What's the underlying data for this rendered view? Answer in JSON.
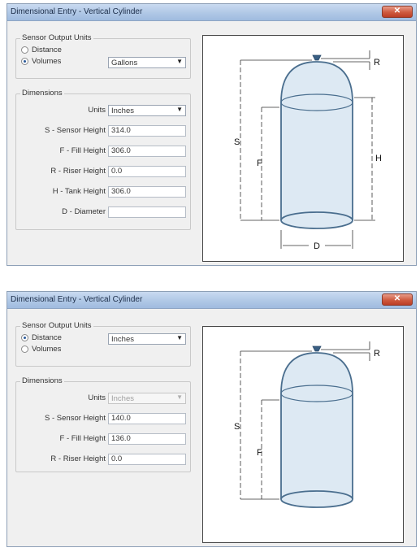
{
  "window_title": "Dimensional Entry - Vertical Cylinder",
  "close_glyph": "✕",
  "dropdown_arrow": "▼",
  "panels": [
    {
      "sensor_output_units": {
        "legend": "Sensor Output Units",
        "options": [
          {
            "label": "Distance",
            "checked": false
          },
          {
            "label": "Volumes",
            "checked": true
          }
        ],
        "select_value": "Gallons"
      },
      "dimensions": {
        "legend": "Dimensions",
        "units_label": "Units",
        "units_value": "Inches",
        "fields": [
          {
            "label": "S - Sensor Height",
            "value": "314.0"
          },
          {
            "label": "F - Fill Height",
            "value": "306.0"
          },
          {
            "label": "R - Riser Height",
            "value": "0.0"
          },
          {
            "label": "H - Tank Height",
            "value": "306.0"
          },
          {
            "label": "D - Diameter",
            "value": ""
          }
        ]
      },
      "diagram_labels": {
        "R": "R",
        "S": "S",
        "F": "F",
        "H": "H",
        "D": "D"
      }
    },
    {
      "sensor_output_units": {
        "legend": "Sensor Output Units",
        "options": [
          {
            "label": "Distance",
            "checked": true
          },
          {
            "label": "Volumes",
            "checked": false
          }
        ],
        "select_value": "Inches"
      },
      "dimensions": {
        "legend": "Dimensions",
        "units_label": "Units",
        "units_value": "Inches",
        "fields": [
          {
            "label": "S - Sensor Height",
            "value": "140.0"
          },
          {
            "label": "F - Fill Height",
            "value": "136.0"
          },
          {
            "label": "R - Riser Height",
            "value": "0.0"
          }
        ]
      },
      "diagram_labels": {
        "R": "R",
        "S": "S",
        "F": "F"
      }
    }
  ]
}
